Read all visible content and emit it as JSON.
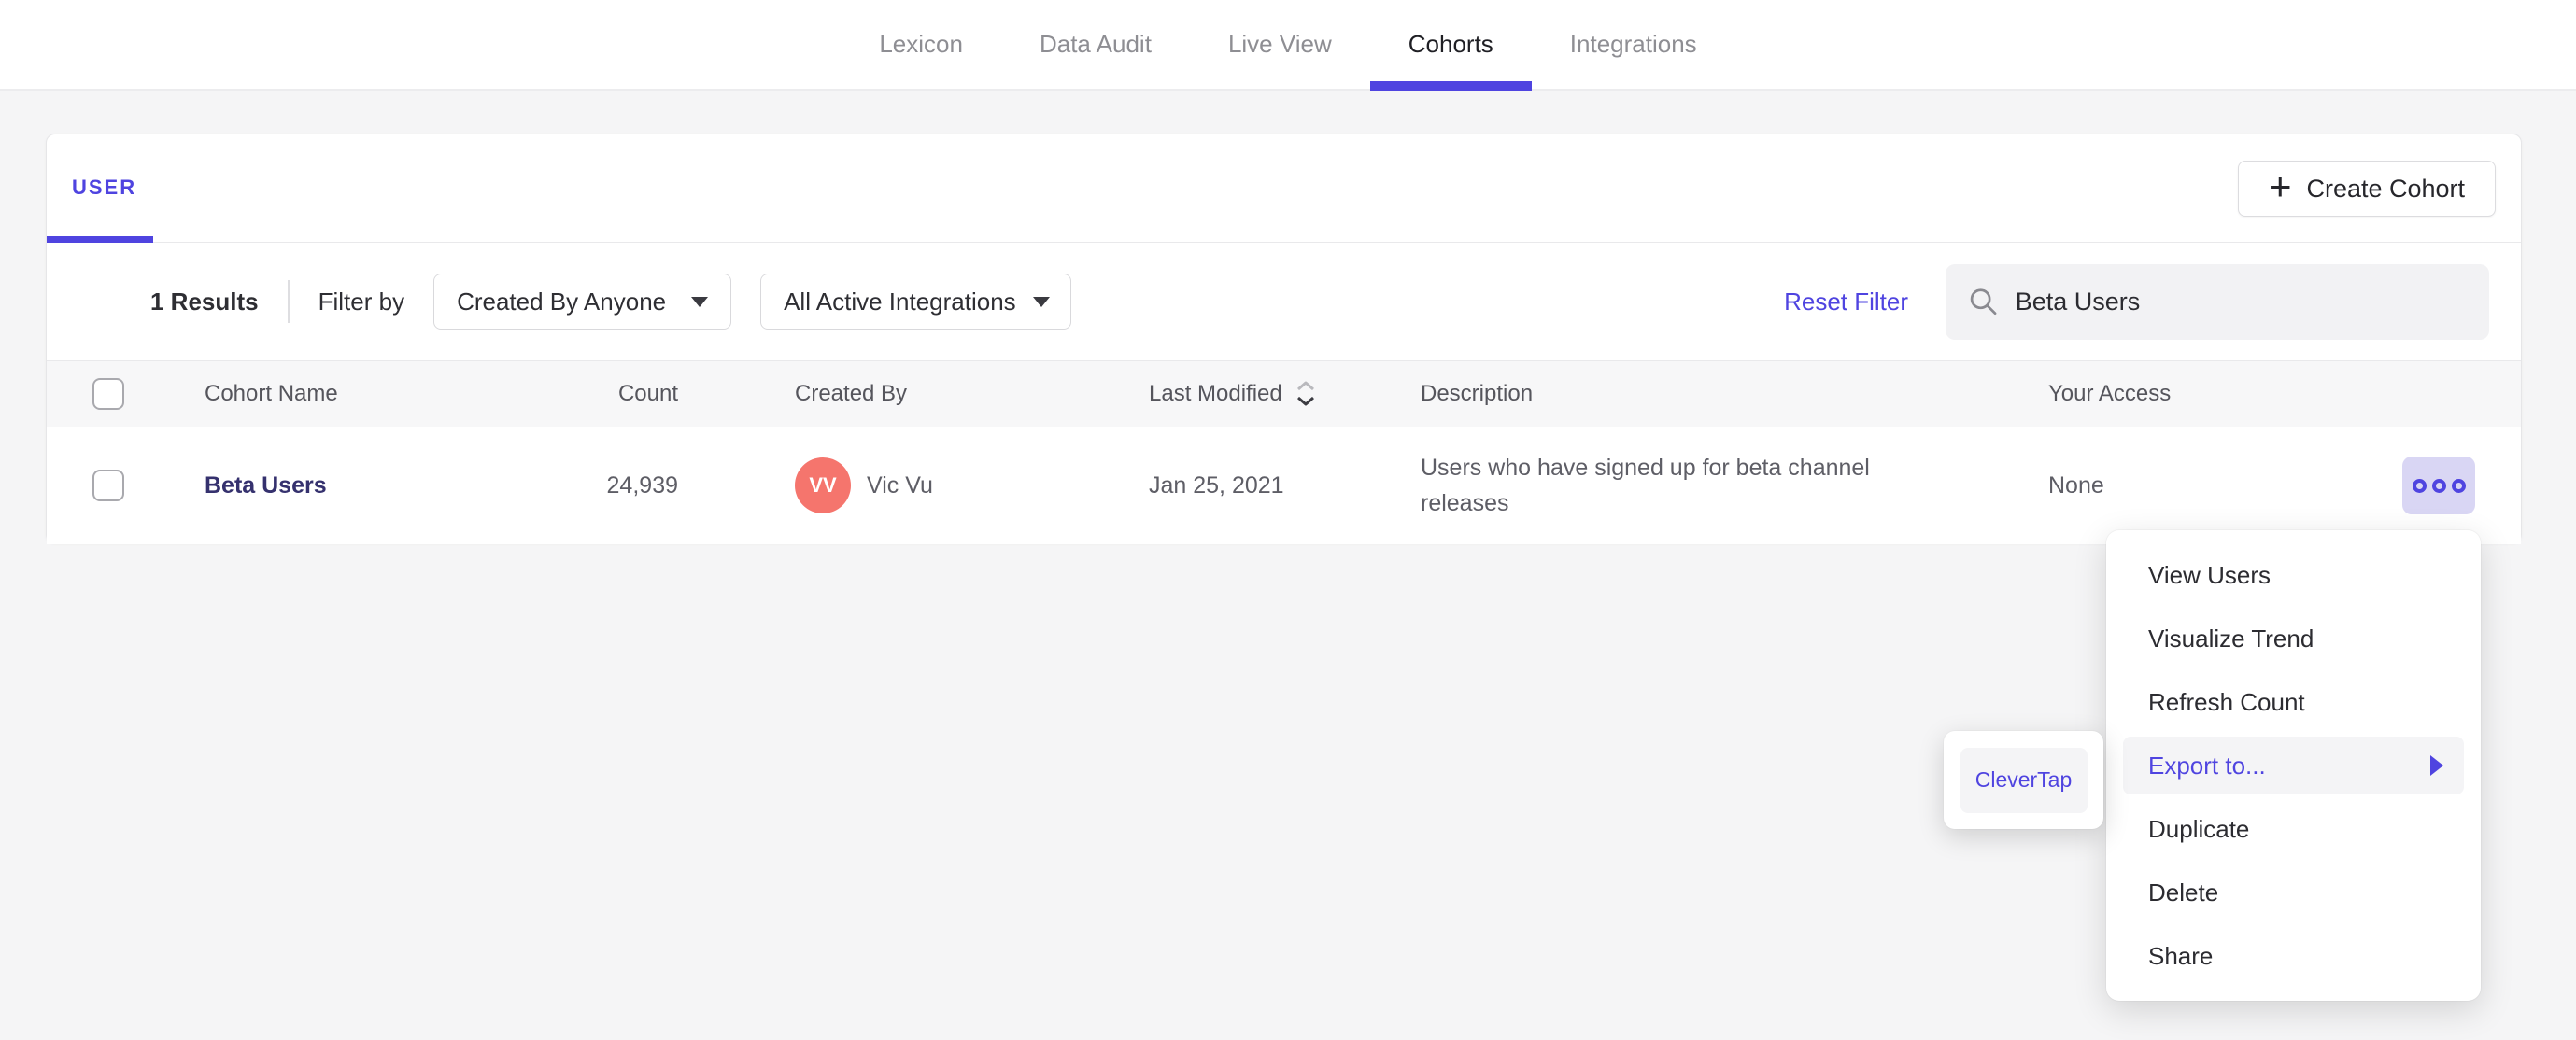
{
  "nav": {
    "items": [
      "Lexicon",
      "Data Audit",
      "Live View",
      "Cohorts",
      "Integrations"
    ],
    "active": "Cohorts"
  },
  "panel": {
    "tab_label": "USER",
    "create_button_label": "Create Cohort",
    "filter_bar": {
      "results_count": "1 Results",
      "filter_by_label": "Filter by",
      "created_by_dropdown": "Created By Anyone",
      "integrations_dropdown": "All Active Integrations",
      "reset_label": "Reset Filter",
      "search_value": "Beta Users"
    },
    "table": {
      "columns": [
        "Cohort Name",
        "Count",
        "Created By",
        "Last Modified",
        "Description",
        "Your Access"
      ],
      "rows": [
        {
          "name": "Beta Users",
          "count": "24,939",
          "creator_initials": "VV",
          "creator_name": "Vic Vu",
          "last_modified": "Jan 25, 2021",
          "description": "Users who have signed up for beta channel releases",
          "access": "None"
        }
      ]
    }
  },
  "context_menu": {
    "items": [
      "View Users",
      "Visualize Trend",
      "Refresh Count",
      "Export to...",
      "Duplicate",
      "Delete",
      "Share"
    ],
    "highlighted_item": "Export to...",
    "submenu": {
      "items": [
        "CleverTap"
      ]
    }
  },
  "icons": {
    "plus": "+",
    "caret_down": "filled-triangle-down",
    "sort": "chevron-up-down",
    "search": "magnifier",
    "more": "three-ring-dots",
    "submenu_arrow": "filled-triangle-right"
  },
  "colors": {
    "accent": "#4f44e0",
    "avatar": "#f5756d",
    "link": "#35316e",
    "page-bg": "#f5f5f6",
    "highlight-bg": "#f4f4f6",
    "dots-bg": "#d9d6f4"
  }
}
